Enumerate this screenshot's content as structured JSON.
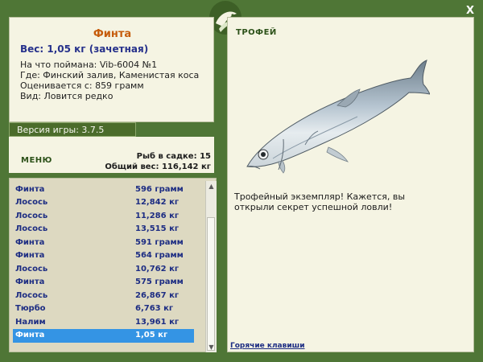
{
  "colors": {
    "frame_green": "#4f7636",
    "panel_bg": "#f5f4e3",
    "list_bg": "#ddd9c1",
    "selected": "#3494e4",
    "title_orange": "#c65c0c",
    "text_blue": "#1d2d83"
  },
  "fish": {
    "name": "Финта",
    "weight": "Вес: 1,05 кг (зачетная)",
    "bait": "На что поймана: Vib-6004 №1",
    "location": "Где: Финский залив, Каменистая коса",
    "estimated": "Оценивается с: 859 грамм",
    "kind": "Вид: Ловится редко"
  },
  "version": "Версия игры: 3.7.5",
  "menu_label": "МЕНЮ",
  "stats": {
    "count": "Рыб в садке: 15",
    "total": "Общий вес: 116,142 кг"
  },
  "catch_list": [
    {
      "name": "Финта",
      "weight": "596 грамм"
    },
    {
      "name": "Лосось",
      "weight": "12,842 кг"
    },
    {
      "name": "Лосось",
      "weight": "11,286 кг"
    },
    {
      "name": "Лосось",
      "weight": "13,515 кг"
    },
    {
      "name": "Финта",
      "weight": "591 грамм"
    },
    {
      "name": "Финта",
      "weight": "564 грамм"
    },
    {
      "name": "Лосось",
      "weight": "10,762 кг"
    },
    {
      "name": "Финта",
      "weight": "575 грамм"
    },
    {
      "name": "Лосось",
      "weight": "26,867 кг"
    },
    {
      "name": "Тюрбо",
      "weight": "6,763 кг"
    },
    {
      "name": "Налим",
      "weight": "13,961 кг"
    },
    {
      "name": "Финта",
      "weight": "1,05 кг"
    }
  ],
  "selected_index": 11,
  "trophy": {
    "label": "ТРОФЕЙ",
    "text": "Трофейный экземпляр! Кажется, вы открыли секрет успешной ловли!"
  },
  "hotkeys": "Горячие клавиши",
  "close_symbol": "X",
  "icons": {
    "close": "close-icon",
    "logo": "fish-logo-icon",
    "scroll_up": "arrow-up-icon",
    "scroll_down": "arrow-down-icon"
  }
}
